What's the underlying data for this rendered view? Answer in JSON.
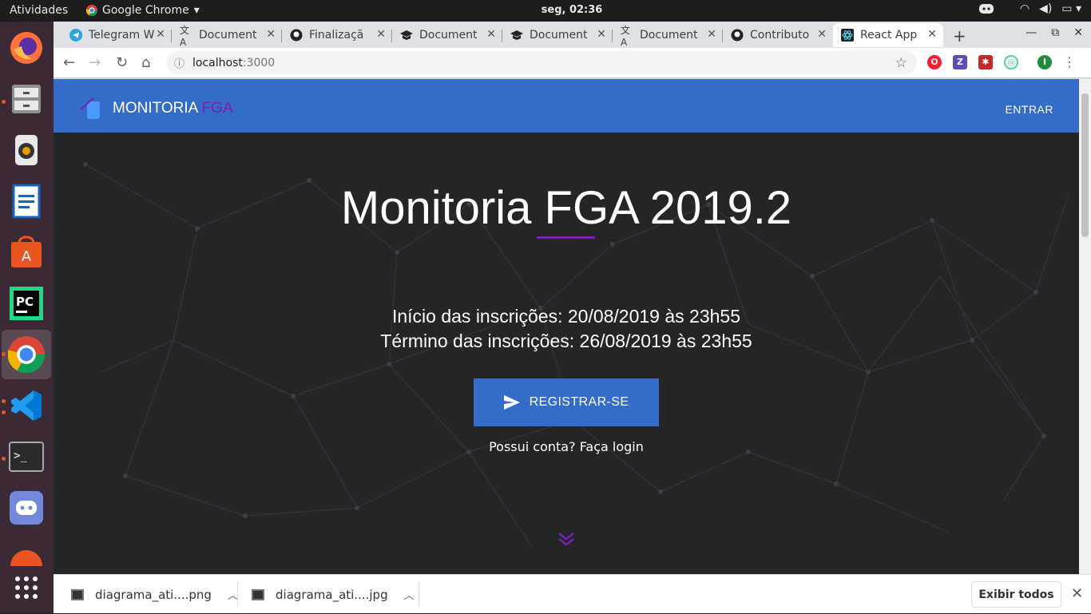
{
  "topbar": {
    "activities": "Atividades",
    "app": "Google Chrome",
    "clock": "seg, 02:36"
  },
  "tabs": [
    {
      "label": "Telegram W",
      "icon": "telegram-icon"
    },
    {
      "label": "Document",
      "icon": "translate-icon"
    },
    {
      "label": "Finalizaçã",
      "icon": "github-icon"
    },
    {
      "label": "Document",
      "icon": "graduation-cap-icon"
    },
    {
      "label": "Document",
      "icon": "graduation-cap-icon"
    },
    {
      "label": "Document",
      "icon": "translate-icon"
    },
    {
      "label": "Contributo",
      "icon": "github-icon"
    },
    {
      "label": "React App",
      "icon": "react-icon"
    }
  ],
  "omnibox": {
    "host": "localhost",
    "port": ":3000"
  },
  "page": {
    "brand_main": "MONITORIA",
    "brand_accent": "FGA",
    "nav_enter": "ENTRAR",
    "hero_title": "Monitoria FGA 2019.2",
    "start_date": "Início das inscrições: 20/08/2019 às 23h55",
    "end_date": "Término das inscrições: 26/08/2019 às 23h55",
    "register": "REGISTRAR-SE",
    "login_link": "Possui conta? Faça login"
  },
  "downloads": [
    {
      "name": "diagrama_ati....png"
    },
    {
      "name": "diagrama_ati....jpg"
    }
  ],
  "downloads_show_all": "Exibir todos",
  "colors": {
    "primary": "#346cc9",
    "accent": "#7a1fb5",
    "background": "#242527"
  }
}
